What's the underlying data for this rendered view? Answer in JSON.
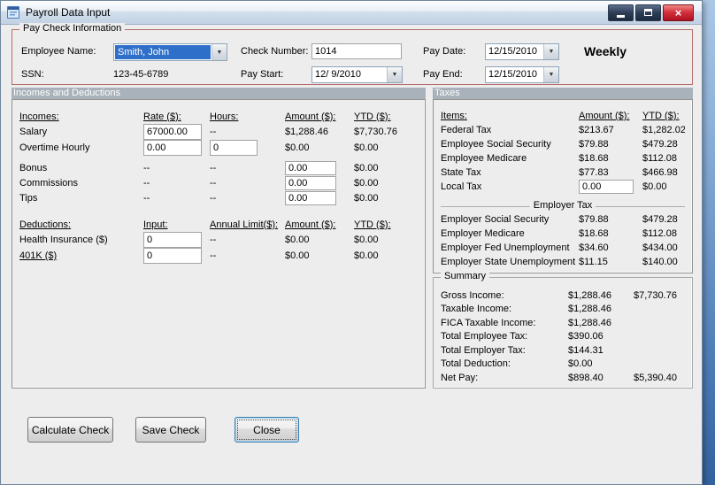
{
  "window": {
    "title": "Payroll Data Input"
  },
  "icons": {
    "dropdown": "▼",
    "close_glyph": "×"
  },
  "paycheck": {
    "group_title": "Pay Check Information",
    "employee_name_label": "Employee Name:",
    "employee_name": "Smith, John",
    "ssn_label": "SSN:",
    "ssn": "123-45-6789",
    "check_number_label": "Check Number:",
    "check_number": "1014",
    "pay_start_label": "Pay Start:",
    "pay_start": "12/ 9/2010",
    "pay_date_label": "Pay Date:",
    "pay_date": "12/15/2010",
    "pay_end_label": "Pay End:",
    "pay_end": "12/15/2010",
    "frequency": "Weekly"
  },
  "sections": {
    "incomes_header": "Incomes and Deductions",
    "taxes_header": "Taxes"
  },
  "incomes": {
    "title": "Incomes:",
    "col_rate": "Rate ($):",
    "col_hours": "Hours:",
    "col_amount": "Amount ($):",
    "col_ytd": "YTD ($):",
    "rows": [
      {
        "label": "Salary",
        "rate": "67000.00",
        "hours": "--",
        "amount": "$1,288.46",
        "ytd": "$7,730.76"
      },
      {
        "label": "Overtime Hourly",
        "rate": "0.00",
        "hours": "0",
        "amount": "$0.00",
        "ytd": "$0.00"
      },
      {
        "label": "Bonus",
        "rate": "--",
        "hours": "--",
        "amount": "0.00",
        "ytd": "$0.00"
      },
      {
        "label": "Commissions",
        "rate": "--",
        "hours": "--",
        "amount": "0.00",
        "ytd": "$0.00"
      },
      {
        "label": "Tips",
        "rate": "--",
        "hours": "--",
        "amount": "0.00",
        "ytd": "$0.00"
      }
    ]
  },
  "deductions": {
    "title": "Deductions:",
    "col_input": "Input:",
    "col_limit": "Annual Limit($):",
    "col_amount": "Amount ($):",
    "col_ytd": "YTD ($):",
    "rows": [
      {
        "label": "Health Insurance  ($)",
        "input": "0",
        "limit": "--",
        "amount": "$0.00",
        "ytd": "$0.00"
      },
      {
        "label": "401K  ($)",
        "input": "0",
        "limit": "--",
        "amount": "$0.00",
        "ytd": "$0.00"
      }
    ]
  },
  "taxes": {
    "col_items": "Items:",
    "col_amount": "Amount ($):",
    "col_ytd": "YTD ($):",
    "rows": [
      {
        "label": "Federal Tax",
        "amount": "$213.67",
        "ytd": "$1,282.02"
      },
      {
        "label": "Employee Social Security",
        "amount": "$79.88",
        "ytd": "$479.28"
      },
      {
        "label": "Employee Medicare",
        "amount": "$18.68",
        "ytd": "$112.08"
      },
      {
        "label": "State Tax",
        "amount": "$77.83",
        "ytd": "$466.98"
      }
    ],
    "local_tax": {
      "label": "Local Tax",
      "amount": "0.00",
      "ytd": "$0.00"
    },
    "employer_group_title": "Employer Tax",
    "employer_rows": [
      {
        "label": "Employer Social Security",
        "amount": "$79.88",
        "ytd": "$479.28"
      },
      {
        "label": "Employer Medicare",
        "amount": "$18.68",
        "ytd": "$112.08"
      },
      {
        "label": "Employer Fed Unemployment",
        "amount": "$34.60",
        "ytd": "$434.00"
      },
      {
        "label": "Employer State Unemployment",
        "amount": "$11.15",
        "ytd": "$140.00"
      }
    ]
  },
  "summary": {
    "group_title": "Summary",
    "rows": [
      {
        "label": "Gross Income:",
        "amount": "$1,288.46",
        "ytd": "$7,730.76"
      },
      {
        "label": "Taxable Income:",
        "amount": "$1,288.46",
        "ytd": ""
      },
      {
        "label": "FICA Taxable Income:",
        "amount": "$1,288.46",
        "ytd": ""
      },
      {
        "label": "Total Employee Tax:",
        "amount": "$390.06",
        "ytd": ""
      },
      {
        "label": "Total Employer Tax:",
        "amount": "$144.31",
        "ytd": ""
      },
      {
        "label": "Total Deduction:",
        "amount": "$0.00",
        "ytd": ""
      },
      {
        "label": "Net Pay:",
        "amount": "$898.40",
        "ytd": "$5,390.40"
      }
    ]
  },
  "buttons": {
    "calculate": "Calculate Check",
    "save": "Save Check",
    "close": "Close"
  },
  "colors": {
    "section_header_bg": "#a9b2ba",
    "group_border_red": "#b66a6a",
    "selection_blue": "#2e6fc9",
    "close_button_red": "#d4323d"
  }
}
